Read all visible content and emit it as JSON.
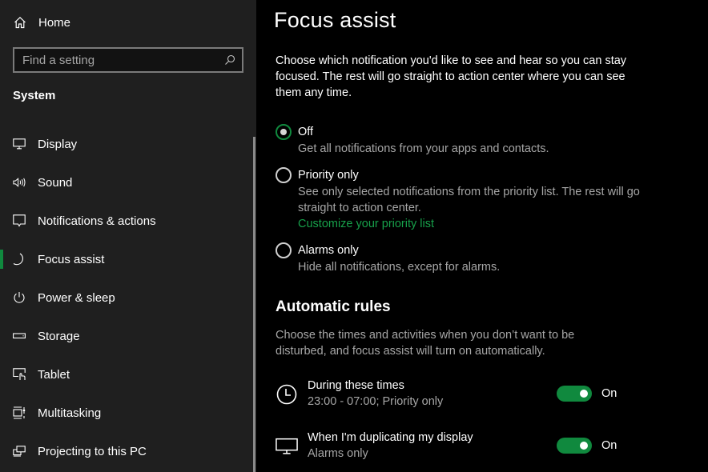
{
  "sidebar": {
    "home_label": "Home",
    "search": {
      "placeholder": "Find a setting",
      "value": ""
    },
    "section_title": "System",
    "items": [
      {
        "label": "Display",
        "icon": "monitor-icon",
        "active": false
      },
      {
        "label": "Sound",
        "icon": "speaker-icon",
        "active": false
      },
      {
        "label": "Notifications & actions",
        "icon": "message-icon",
        "active": false
      },
      {
        "label": "Focus assist",
        "icon": "moon-icon",
        "active": true
      },
      {
        "label": "Power & sleep",
        "icon": "power-icon",
        "active": false
      },
      {
        "label": "Storage",
        "icon": "drive-icon",
        "active": false
      },
      {
        "label": "Tablet",
        "icon": "tablet-icon",
        "active": false
      },
      {
        "label": "Multitasking",
        "icon": "multitasking-icon",
        "active": false
      },
      {
        "label": "Projecting to this PC",
        "icon": "projecting-icon",
        "active": false
      }
    ]
  },
  "main": {
    "title": "Focus assist",
    "intro": "Choose which notification you'd like to see and hear so you can stay focused. The rest will go straight to action center where you can see them any time.",
    "options": [
      {
        "label": "Off",
        "description": "Get all notifications from your apps and contacts.",
        "selected": true
      },
      {
        "label": "Priority only",
        "description": "See only selected notifications from the priority list. The rest will go straight to action center.",
        "link": "Customize your priority list",
        "selected": false
      },
      {
        "label": "Alarms only",
        "description": "Hide all notifications, except for alarms.",
        "selected": false
      }
    ],
    "automatic_rules": {
      "title": "Automatic rules",
      "description": "Choose the times and activities when you don’t want to be disturbed, and focus assist will turn on automatically.",
      "rules": [
        {
          "name": "During these times",
          "value": "23:00 - 07:00; Priority only",
          "icon": "clock-icon",
          "toggle_on": true,
          "toggle_label": "On"
        },
        {
          "name": "When I'm duplicating my display",
          "value": "Alarms only",
          "icon": "monitor-icon",
          "toggle_on": true,
          "toggle_label": "On"
        }
      ]
    }
  },
  "colors": {
    "accent": "#10893e",
    "link": "#17a04a",
    "sidebar_bg": "#1f1f1f",
    "main_bg": "#000000",
    "secondary_text": "#a6a6a6"
  }
}
